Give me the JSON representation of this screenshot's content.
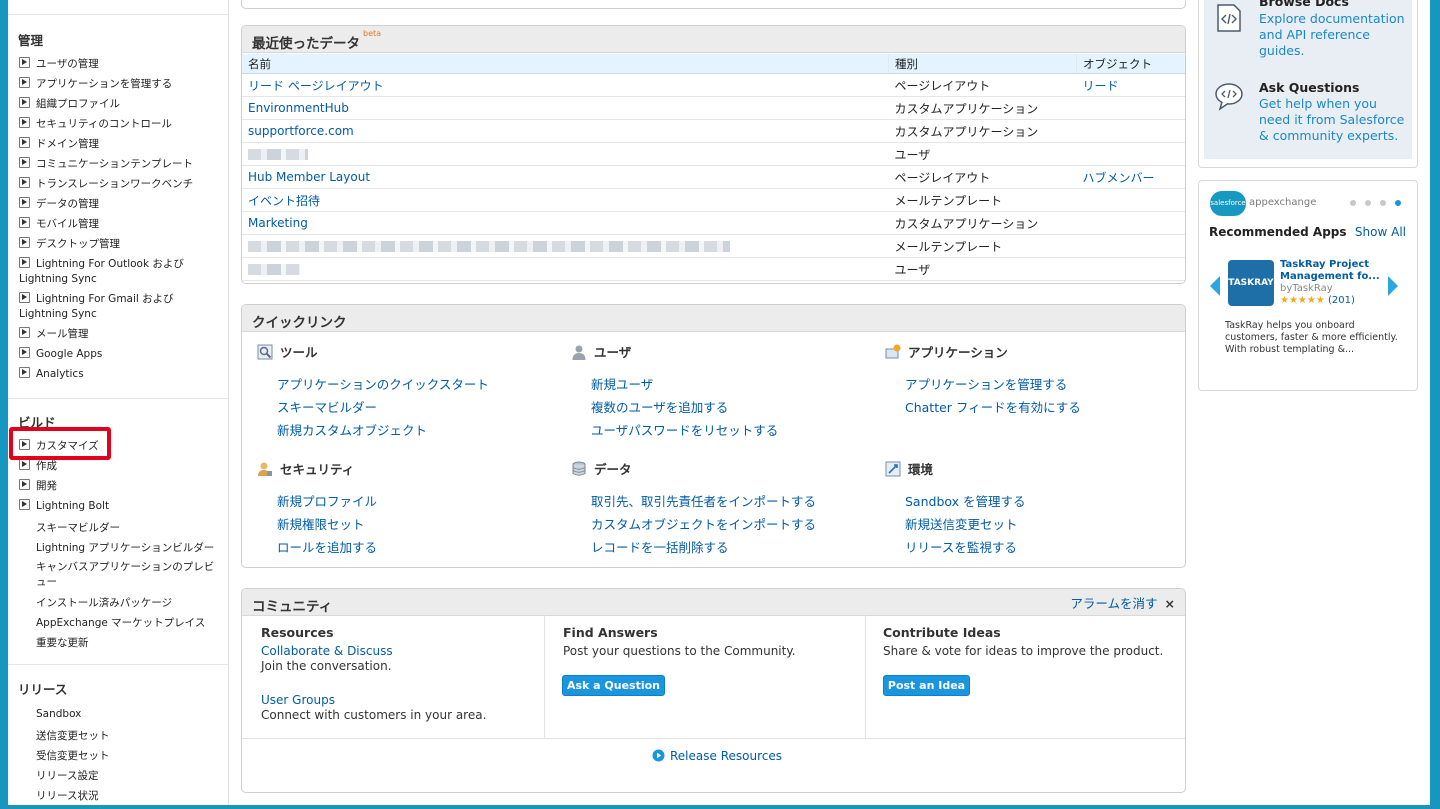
{
  "sidebar": {
    "admin_header": "管理",
    "admin_items": [
      "ユーザの管理",
      "アプリケーションを管理する",
      "組織プロファイル",
      "セキュリティのコントロール",
      "ドメイン管理",
      "コミュニケーションテンプレート",
      "トランスレーションワークベンチ",
      "データの管理",
      "モバイル管理",
      "デスクトップ管理",
      "Lightning For Outlook および Lightning Sync",
      "Lightning For Gmail および Lightning Sync",
      "メール管理",
      "Google Apps",
      "Analytics"
    ],
    "build_header": "ビルド",
    "build_items": [
      "カスタマイズ",
      "作成",
      "開発",
      "Lightning Bolt"
    ],
    "build_plain": [
      "スキーマビルダー",
      "Lightning アプリケーションビルダー",
      "キャンバスアプリケーションのプレビュー",
      "インストール済みパッケージ",
      "AppExchange マーケットプレイス",
      "重要な更新"
    ],
    "release_header": "リリース",
    "release_items": [
      "Sandbox",
      "送信変更セット",
      "受信変更セット",
      "リリース設定",
      "リリース状況"
    ]
  },
  "recent": {
    "title": "最近使ったデータ",
    "beta": "beta",
    "headers": [
      "名前",
      "種別",
      "オブジェクト"
    ],
    "rows": [
      [
        "リード ページレイアウト",
        "ページレイアウト",
        "リード"
      ],
      [
        "EnvironmentHub",
        "カスタムアプリケーション",
        ""
      ],
      [
        "supportforce.com",
        "カスタムアプリケーション",
        ""
      ],
      [
        "",
        "ユーザ",
        ""
      ],
      [
        "Hub Member Layout",
        "ページレイアウト",
        "ハブメンバー"
      ],
      [
        "イベント招待",
        "メールテンプレート",
        ""
      ],
      [
        "Marketing",
        "カスタムアプリケーション",
        ""
      ],
      [
        "",
        "メールテンプレート",
        ""
      ],
      [
        "",
        "ユーザ",
        ""
      ]
    ]
  },
  "quicklinks": {
    "title": "クイックリンク",
    "tools": {
      "label": "ツール",
      "links": [
        "アプリケーションのクイックスタート",
        "スキーマビルダー",
        "新規カスタムオブジェクト"
      ]
    },
    "users": {
      "label": "ユーザ",
      "links": [
        "新規ユーザ",
        "複数のユーザを追加する",
        "ユーザパスワードをリセットする"
      ]
    },
    "apps": {
      "label": "アプリケーション",
      "links": [
        "アプリケーションを管理する",
        "Chatter フィードを有効にする"
      ]
    },
    "security": {
      "label": "セキュリティ",
      "links": [
        "新規プロファイル",
        "新規権限セット",
        "ロールを追加する"
      ]
    },
    "data": {
      "label": "データ",
      "links": [
        "取引先、取引先責任者をインポートする",
        "カスタムオブジェクトをインポートする",
        "レコードを一括削除する"
      ]
    },
    "env": {
      "label": "環境",
      "links": [
        "Sandbox を管理する",
        "新規送信変更セット",
        "リリースを監視する"
      ]
    }
  },
  "community": {
    "title": "コミュニティ",
    "dismiss": "アラームを消す",
    "resources": {
      "title": "Resources",
      "link1": "Collaborate & Discuss",
      "text1": "Join the conversation.",
      "link2": "User Groups",
      "text2": "Connect with customers in your area."
    },
    "answers": {
      "title": "Find Answers",
      "text": "Post your questions to the Community.",
      "button": "Ask a Question"
    },
    "ideas": {
      "title": "Contribute Ideas",
      "text": "Share & vote for ideas to improve the product.",
      "button": "Post an Idea"
    },
    "release_link": "Release Resources"
  },
  "help": {
    "docs_title": "Browse Docs",
    "docs_text": "Explore documentation and API reference guides.",
    "ask_title": "Ask Questions",
    "ask_text": "Get help when you need it from Salesforce & community experts."
  },
  "appexchange": {
    "brand": "salesforce",
    "name": "appexchange",
    "heading": "Recommended Apps",
    "show_all": "Show All",
    "app_logo": "TASKRAY",
    "app_name": "TaskRay Project Management fo...",
    "app_by": "byTaskRay",
    "stars": "★★★★★",
    "reviews": "(201)",
    "desc": "TaskRay helps you onboard customers, faster & more efficiently. With robust templating &..."
  }
}
